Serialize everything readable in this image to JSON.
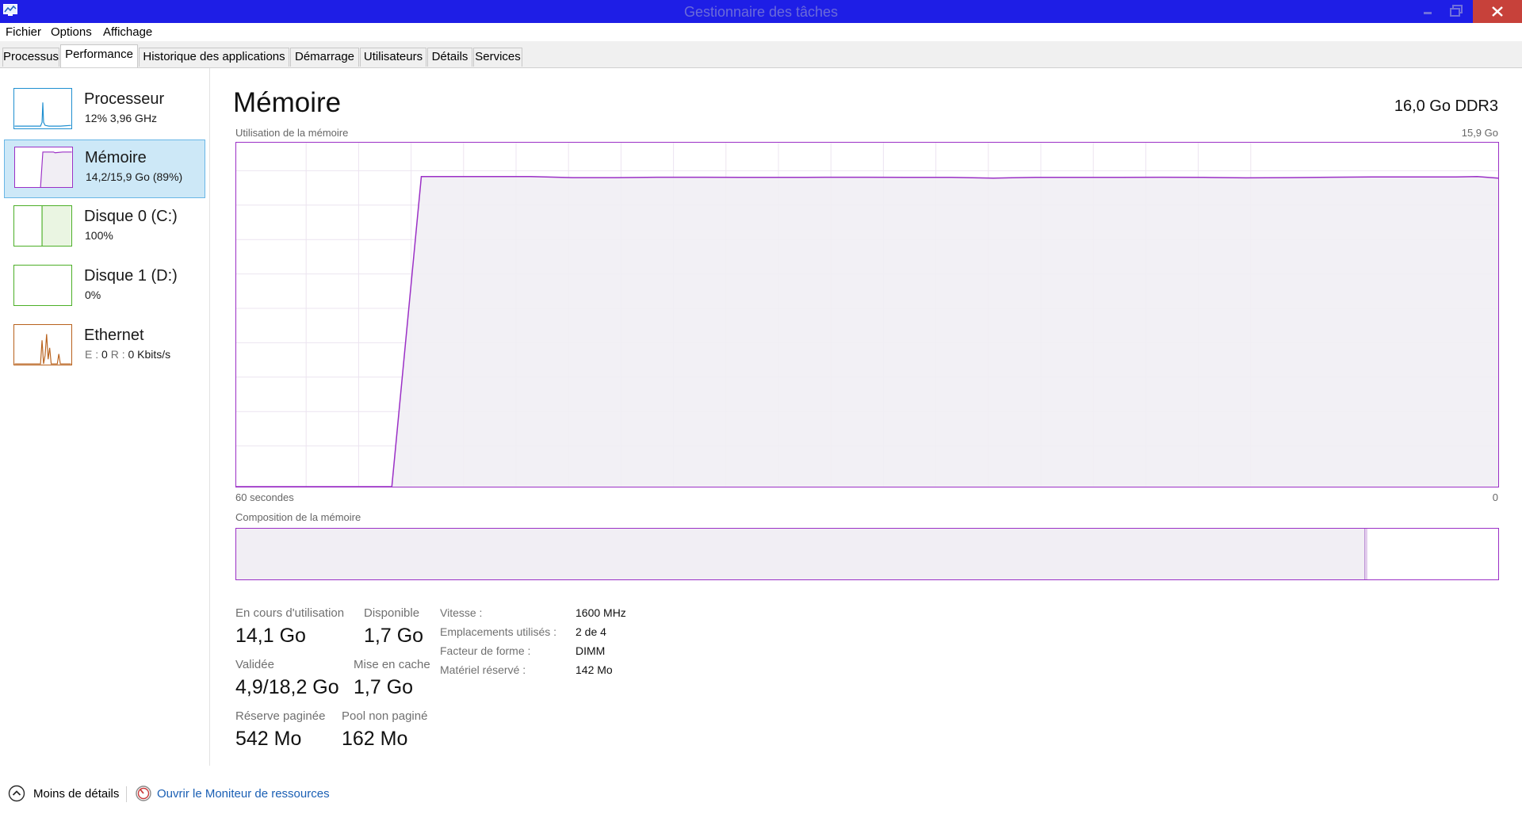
{
  "window": {
    "title": "Gestionnaire des tâches"
  },
  "menu": [
    "Fichier",
    "Options",
    "Affichage"
  ],
  "tabs": [
    "Processus",
    "Performance",
    "Historique des applications",
    "Démarrage",
    "Utilisateurs",
    "Détails",
    "Services"
  ],
  "active_tab": "Performance",
  "sidebar": {
    "items": [
      {
        "title": "Processeur",
        "sub": "12%  3,96 GHz",
        "color": "#1f8fd0"
      },
      {
        "title": "Mémoire",
        "sub": "14,2/15,9 Go (89%)",
        "color": "#9b30c6"
      },
      {
        "title": "Disque 0 (C:)",
        "sub": "100%",
        "color": "#4caf27"
      },
      {
        "title": "Disque 1 (D:)",
        "sub": "0%",
        "color": "#4caf27"
      },
      {
        "title": "Ethernet",
        "sub_prefix_e": "E : ",
        "sub_e": "0",
        "sub_prefix_r": "R : ",
        "sub_r": "0 Kbits/s",
        "color": "#b8611c"
      }
    ]
  },
  "main": {
    "title": "Mémoire",
    "spec": "16,0 Go DDR3",
    "usage_label": "Utilisation de la mémoire",
    "usage_max": "15,9 Go",
    "time_label": "60 secondes",
    "time_end": "0",
    "composition_label": "Composition de la mémoire"
  },
  "stats": {
    "in_use_label": "En cours d'utilisation",
    "in_use": "14,1 Go",
    "available_label": "Disponible",
    "available": "1,7 Go",
    "committed_label": "Validée",
    "committed": "4,9/18,2 Go",
    "cached_label": "Mise en cache",
    "cached": "1,7 Go",
    "paged_label": "Réserve paginée",
    "paged": "542 Mo",
    "nonpaged_label": "Pool non paginé",
    "nonpaged": "162 Mo"
  },
  "info": {
    "speed_label": "Vitesse :",
    "speed": "1600 MHz",
    "slots_label": "Emplacements utilisés :",
    "slots": "2 de 4",
    "form_label": "Facteur de forme :",
    "form": "DIMM",
    "reserved_label": "Matériel réservé :",
    "reserved": "142 Mo"
  },
  "footer": {
    "less_details": "Moins de détails",
    "resource_monitor": "Ouvrir le Moniteur de ressources"
  },
  "chart_data": {
    "type": "area",
    "ylabel": "Utilisation de la mémoire",
    "xlabel": "60 secondes",
    "ylim": [
      0,
      15.9
    ],
    "x": [
      60,
      52.6,
      51.2,
      48.3,
      46,
      44,
      42,
      40,
      38,
      36,
      34,
      32,
      30,
      28,
      26,
      24,
      22,
      20,
      18,
      16,
      14,
      12,
      10,
      8,
      6,
      4,
      2,
      1,
      0
    ],
    "values": [
      0,
      0,
      14.4,
      14.4,
      14.4,
      14.35,
      14.35,
      14.37,
      14.37,
      14.36,
      14.36,
      14.37,
      14.37,
      14.36,
      14.36,
      14.33,
      14.36,
      14.36,
      14.36,
      14.37,
      14.36,
      14.34,
      14.35,
      14.37,
      14.38,
      14.38,
      14.38,
      14.4,
      14.33
    ],
    "composition": {
      "in_use_fraction": 0.894,
      "modified_fraction": 0.002
    }
  }
}
